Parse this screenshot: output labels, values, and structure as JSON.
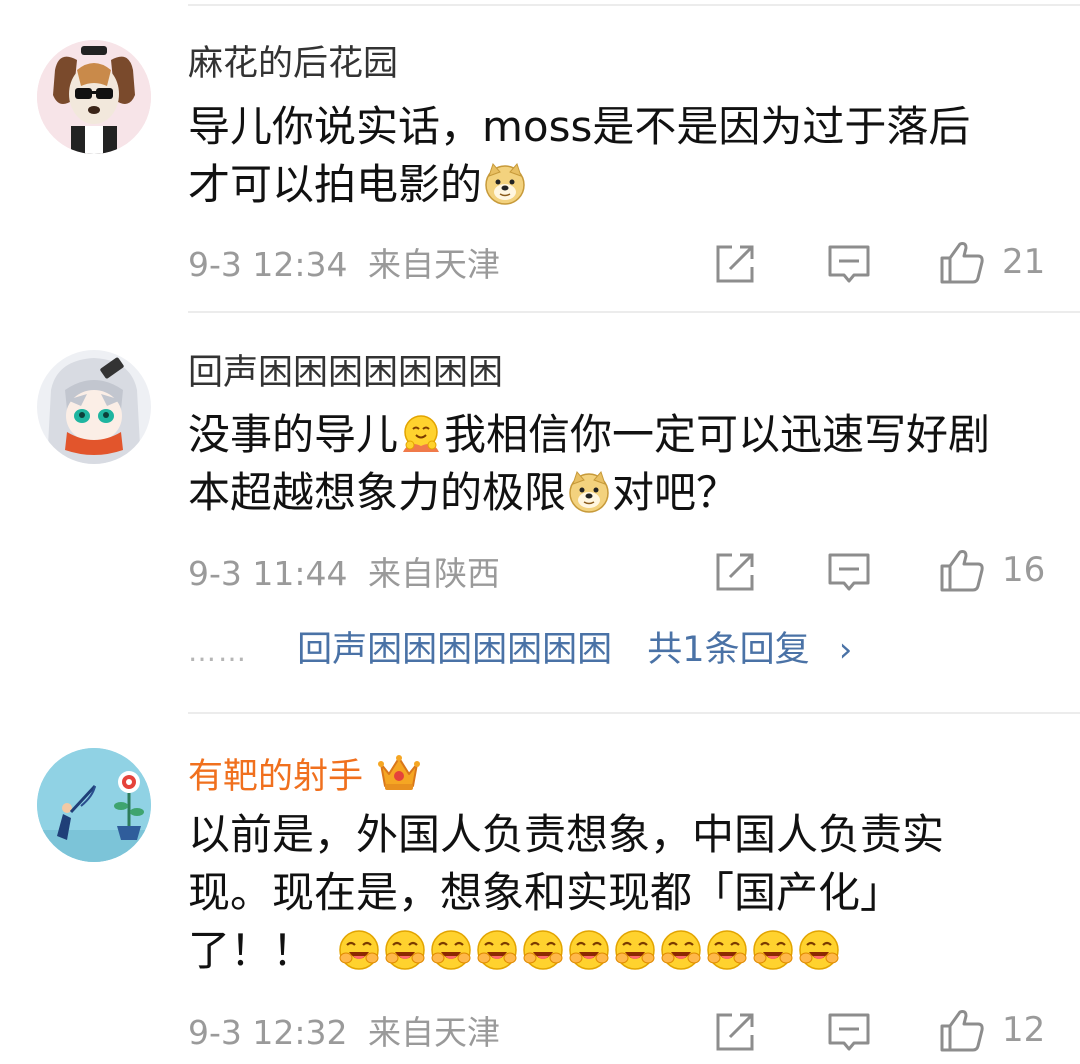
{
  "comments": [
    {
      "username": "麻花的后花园",
      "text_lines": [
        "导儿你说实话，moss是不是因为过于落后",
        "才可以拍电影的"
      ],
      "emoji_line2": "doge-emoji",
      "time": "9-3 12:34",
      "location": "来自天津",
      "likes": "21",
      "avatar": "beagle-dog-avatar"
    },
    {
      "username": "回声困困困困困困困",
      "text_line1_a": "没事的导儿",
      "text_line1_b": "我相信你一定可以迅速写好剧",
      "text_line2_a": "本超越想象力的极限",
      "text_line2_b": "对吧？",
      "emojis": [
        "hug-emoji",
        "doge-emoji"
      ],
      "time": "9-3 11:44",
      "location": "来自陕西",
      "likes": "16",
      "avatar": "anime-girl-avatar",
      "reply": {
        "dots": "……",
        "name": "回声困困困困困困困",
        "count": "共1条回复",
        "chevron": "›"
      }
    },
    {
      "username": "有靶的射手",
      "badge": "crown-icon",
      "text_lines": [
        "以前是，外国人负责想象，中国人负责实",
        "现。现在是，想象和实现都「国产化」",
        "了！！"
      ],
      "emoji_line3": "laugh-emoji",
      "emoji_count": 11,
      "time": "9-3 12:32",
      "location": "来自天津",
      "likes": "12",
      "avatar": "archer-target-avatar"
    }
  ],
  "icons": [
    "share-icon",
    "comment-icon",
    "like-icon"
  ],
  "colors": {
    "username": "#333333",
    "vip_username": "#f0701e",
    "link": "#4a72a6",
    "meta": "#9a9a9a",
    "text": "#111111"
  }
}
